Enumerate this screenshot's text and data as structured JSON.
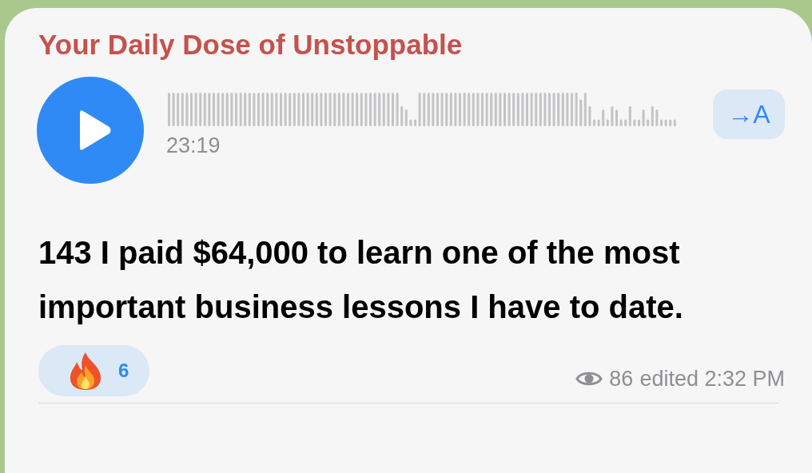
{
  "channel_name": "Your Daily Dose of Unstoppable",
  "voice_message": {
    "duration": "23:19",
    "playing": false
  },
  "translate_button": {
    "label": "→A"
  },
  "message_text": "143 I paid $64,000 to learn one of the most important business lessons I have to date.",
  "reactions": [
    {
      "count": "6",
      "selected": false
    }
  ],
  "footer": {
    "views": "86",
    "status": "edited 2:32 PM"
  }
}
